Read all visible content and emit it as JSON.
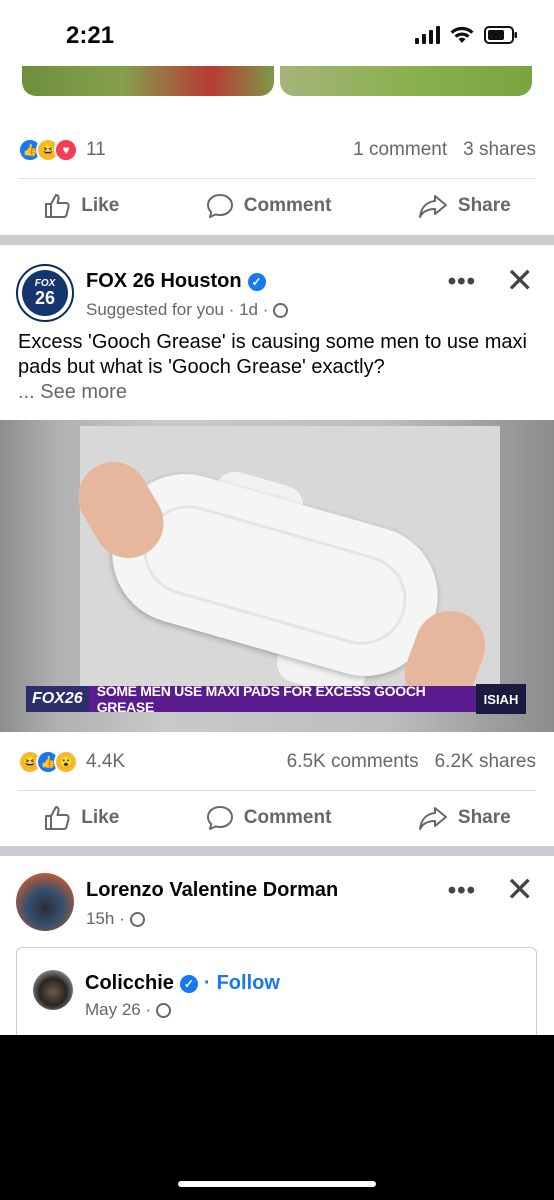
{
  "status_bar": {
    "time": "2:21",
    "icons": [
      "signal-icon",
      "wifi-icon",
      "battery-icon"
    ]
  },
  "prev_post": {
    "reactions": [
      "like",
      "haha",
      "love"
    ],
    "reaction_count": "11",
    "comments": "1 comment",
    "shares": "3 shares"
  },
  "actions": {
    "like": "Like",
    "comment": "Comment",
    "share": "Share"
  },
  "fox_post": {
    "avatar_text_top": "FOX",
    "avatar_text_bottom": "26",
    "author": "FOX 26 Houston",
    "meta": "Suggested for you · 1d ·",
    "more": "•••",
    "close": "✕",
    "text": "Excess 'Gooch Grease' is causing some men to use maxi pads but what is 'Gooch Grease' exactly?",
    "see_more": "... See more",
    "ticker_brand": "FOX26",
    "ticker_headline": "SOME MEN USE MAXI PADS FOR EXCESS GOOCH GREASE",
    "ticker_logo": "ISIAH",
    "reactions": [
      "haha",
      "like",
      "wow"
    ],
    "reaction_count": "4.4K",
    "comments": "6.5K comments",
    "shares": "6.2K shares"
  },
  "lorenzo_post": {
    "author": "Lorenzo Valentine Dorman",
    "meta": "15h ·",
    "more": "•••",
    "close": "✕",
    "shared": {
      "author": "Colicchie",
      "follow_sep": "·",
      "follow": "Follow",
      "meta": "May 26 ·"
    }
  },
  "colors": {
    "accent": "#1877f2",
    "muted": "#65676b",
    "separator": "#c9ccd1"
  }
}
